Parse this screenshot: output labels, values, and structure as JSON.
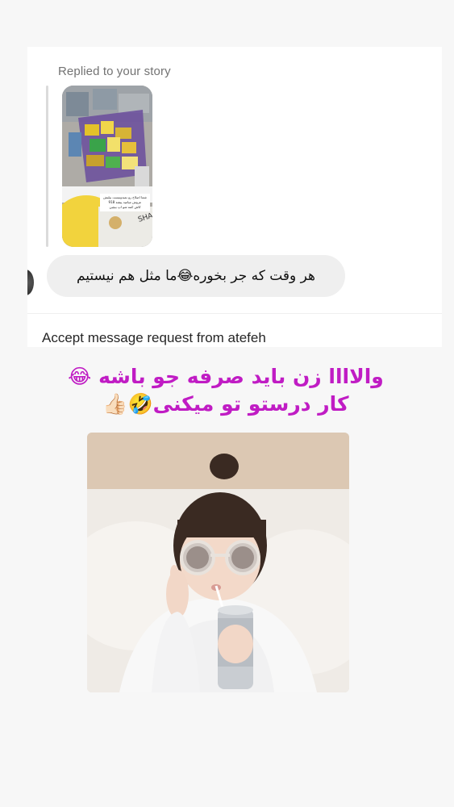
{
  "dm": {
    "reply_label": "Replied to your story",
    "message": "هر وقت که جر بخوره😂ما مثل هم نیستیم",
    "request_text": "Accept message request from atefeh"
  },
  "overlay": {
    "line1": "والاااا زن باید صرفه جو باشه 😂",
    "line2": "کار درستو تو میکنی🤣👍🏻"
  },
  "story_caption_lines": [
    "شما اصلاح رو نمیدونیست بیلیش",
    "عروش میامید پیشه 918",
    "کاش کمه شو اپ بیچین"
  ],
  "colors": {
    "overlay_text": "#c01cc4",
    "bubble": "#efefef",
    "label_gray": "#737373"
  }
}
